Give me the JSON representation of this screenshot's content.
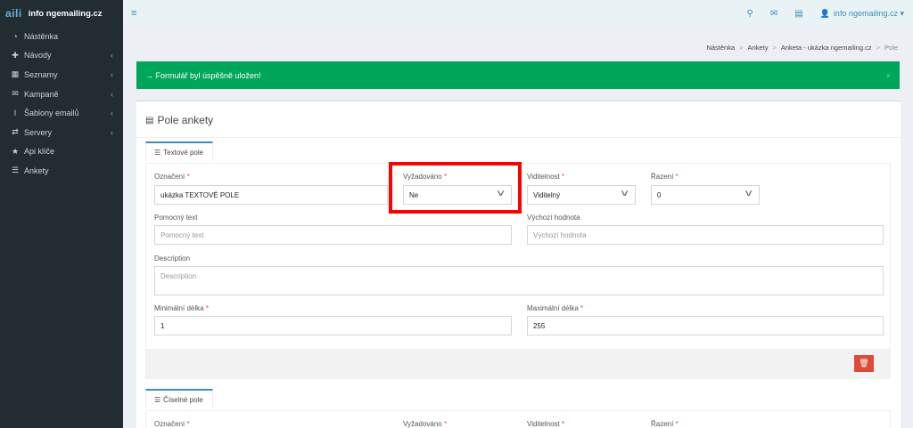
{
  "sidebar": {
    "logo_mark": "aili",
    "logo_text": "info ngemailing.cz",
    "items": [
      {
        "label": "Nástěnka",
        "icon": "dashboard-icon",
        "glyph": "◔",
        "submenu": false
      },
      {
        "label": "Návody",
        "icon": "help-icon",
        "glyph": "✚",
        "submenu": true
      },
      {
        "label": "Seznamy",
        "icon": "list-icon",
        "glyph": "▦",
        "submenu": true
      },
      {
        "label": "Kampaně",
        "icon": "envelope-icon",
        "glyph": "✉",
        "submenu": true
      },
      {
        "label": "Šablony emailů",
        "icon": "text-cursor-icon",
        "glyph": "I",
        "submenu": true
      },
      {
        "label": "Servery",
        "icon": "exchange-icon",
        "glyph": "⇄",
        "submenu": true
      },
      {
        "label": "Api klíče",
        "icon": "star-icon",
        "glyph": "★",
        "submenu": false
      },
      {
        "label": "Ankety",
        "icon": "list-icon",
        "glyph": "☰",
        "submenu": false
      }
    ]
  },
  "topbar": {
    "menu_glyph": "≡",
    "search_glyph": "⚲",
    "mail_glyph": "✉",
    "card_glyph": "▤",
    "user_glyph": "👤",
    "user_label": "info ngemailing.cz ▾"
  },
  "breadcrumb": {
    "items": [
      "Nástěnka",
      "Ankety",
      "Anketa - ukázka ngemailing.cz"
    ],
    "current": "Pole",
    "sep": ">"
  },
  "alert": {
    "message": "→ Formulář byl úspěšně uložen!",
    "close": "×"
  },
  "box": {
    "title": "Pole ankety",
    "title_glyph": "▤"
  },
  "text_field_tab": {
    "label": "Textové pole",
    "glyph": "☰",
    "oznaceni_label": "Označení",
    "oznaceni_value": "ukázka TEXTOVÉ POLE",
    "vyzadovano_label": "Vyžadováno",
    "vyzadovano_value": "Ne",
    "viditelnost_label": "Viditelnost",
    "viditelnost_value": "Viditelný",
    "razeni_label": "Řazení",
    "razeni_value": "0",
    "pomocny_label": "Pomocný text",
    "pomocny_placeholder": "Pomocný text",
    "vychozi_label": "Výchozí hodnota",
    "vychozi_placeholder": "Výchozí hodnota",
    "description_label": "Description",
    "description_placeholder": "Description",
    "min_label": "Minimální délka",
    "min_value": "1",
    "max_label": "Maximální délka",
    "max_value": "255",
    "required_mark": "*",
    "arrow": "∨",
    "delete_glyph": "🗑"
  },
  "number_field_tab": {
    "label": "Číselné pole",
    "glyph": "☰",
    "oznaceni_label": "Označení",
    "vyzadovano_label": "Vyžadováno",
    "viditelnost_label": "Viditelnost",
    "razeni_label": "Řazení",
    "required_mark": "*"
  },
  "colors": {
    "sidebar_bg": "#222d32",
    "accent": "#3c8dbc",
    "success": "#00a65a",
    "danger": "#dd4b39",
    "highlight": "#ff0000"
  }
}
